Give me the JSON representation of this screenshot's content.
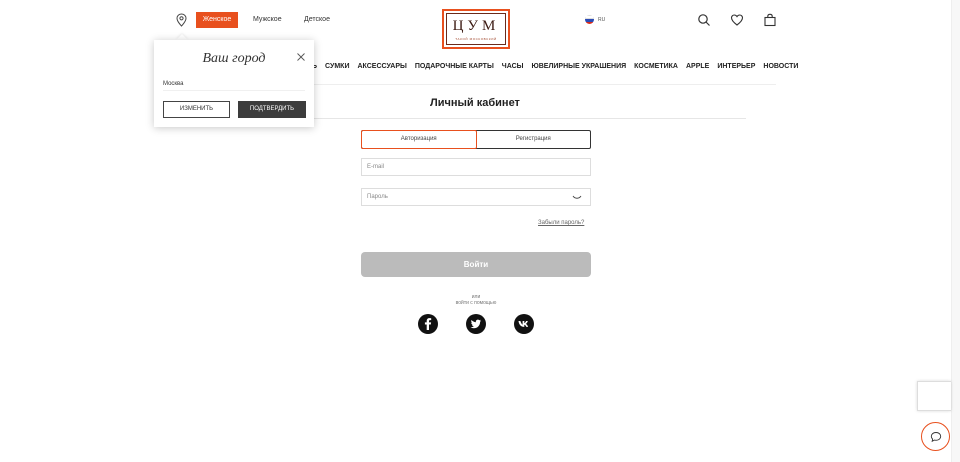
{
  "header": {
    "gender_tabs": [
      "Женское",
      "Мужское",
      "Детское"
    ],
    "active_tab": "Женское",
    "logo_text": "ЦУМ",
    "logo_subtext": "ТАКОЙ МОСКОВСКИЙ",
    "language": "RU",
    "icons": [
      "location-pin-icon",
      "search-icon",
      "heart-icon",
      "shopping-bag-icon"
    ]
  },
  "nav": {
    "partial_item": "Ь",
    "items": [
      "СУМКИ",
      "АКСЕССУАРЫ",
      "ПОДАРОЧНЫЕ КАРТЫ",
      "ЧАСЫ",
      "ЮВЕЛИРНЫЕ УКРАШЕНИЯ",
      "КОСМЕТИКА",
      "APPLE",
      "ИНТЕРЬЕР",
      "НОВОСТИ"
    ]
  },
  "page": {
    "title": "Личный кабинет"
  },
  "auth": {
    "tabs": [
      "Авторизация",
      "Регистрация"
    ],
    "active_tab": "Авторизация",
    "email_placeholder": "E-mail",
    "password_placeholder": "Пароль",
    "forgot_password": "Забыли пароль?",
    "submit_label": "Войти",
    "or_label": "или",
    "social_label": "войти с помощью",
    "social": [
      "facebook-icon",
      "twitter-icon",
      "vk-icon"
    ]
  },
  "city_popup": {
    "title": "Ваш город",
    "city_value": "Москва",
    "change_label": "ИЗМЕНИТЬ",
    "confirm_label": "ПОДТВЕРДИТЬ"
  },
  "colors": {
    "accent": "#e8501e",
    "dark": "#3c3c3c",
    "disabled_button": "#bbbbbb"
  }
}
